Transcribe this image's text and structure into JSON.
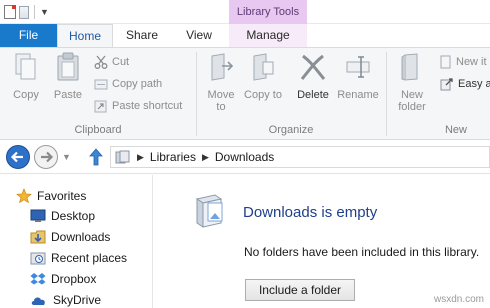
{
  "title_bar": {
    "context_tab_header": "Library Tools"
  },
  "tabs": [
    {
      "label": "File"
    },
    {
      "label": "Home"
    },
    {
      "label": "Share"
    },
    {
      "label": "View"
    },
    {
      "label": "Manage"
    }
  ],
  "ribbon": {
    "clipboard": {
      "group_label": "Clipboard",
      "copy": "Copy",
      "paste": "Paste",
      "cut": "Cut",
      "copy_path": "Copy path",
      "paste_shortcut": "Paste shortcut"
    },
    "organize": {
      "group_label": "Organize",
      "move_to": "Move to",
      "copy_to": "Copy to",
      "delete": "Delete",
      "rename": "Rename"
    },
    "new": {
      "group_label": "New",
      "new_folder": "New folder",
      "new_item": "New it",
      "easy_access": "Easy ac"
    }
  },
  "address_bar": {
    "breadcrumb": [
      "Libraries",
      "Downloads"
    ]
  },
  "nav_pane": {
    "items": [
      {
        "label": "Favorites"
      },
      {
        "label": "Desktop"
      },
      {
        "label": "Downloads"
      },
      {
        "label": "Recent places"
      },
      {
        "label": "Dropbox"
      },
      {
        "label": "SkyDrive"
      }
    ]
  },
  "content": {
    "empty_title": "Downloads is empty",
    "empty_description": "No folders have been included in this library.",
    "include_button": "Include a folder"
  },
  "watermark": "wsxdn.com",
  "colors": {
    "file_tab": "#1979ca",
    "context_header": "#e8c7f0",
    "accent_blue": "#2e71c9",
    "title_text": "#1e3f8a"
  }
}
